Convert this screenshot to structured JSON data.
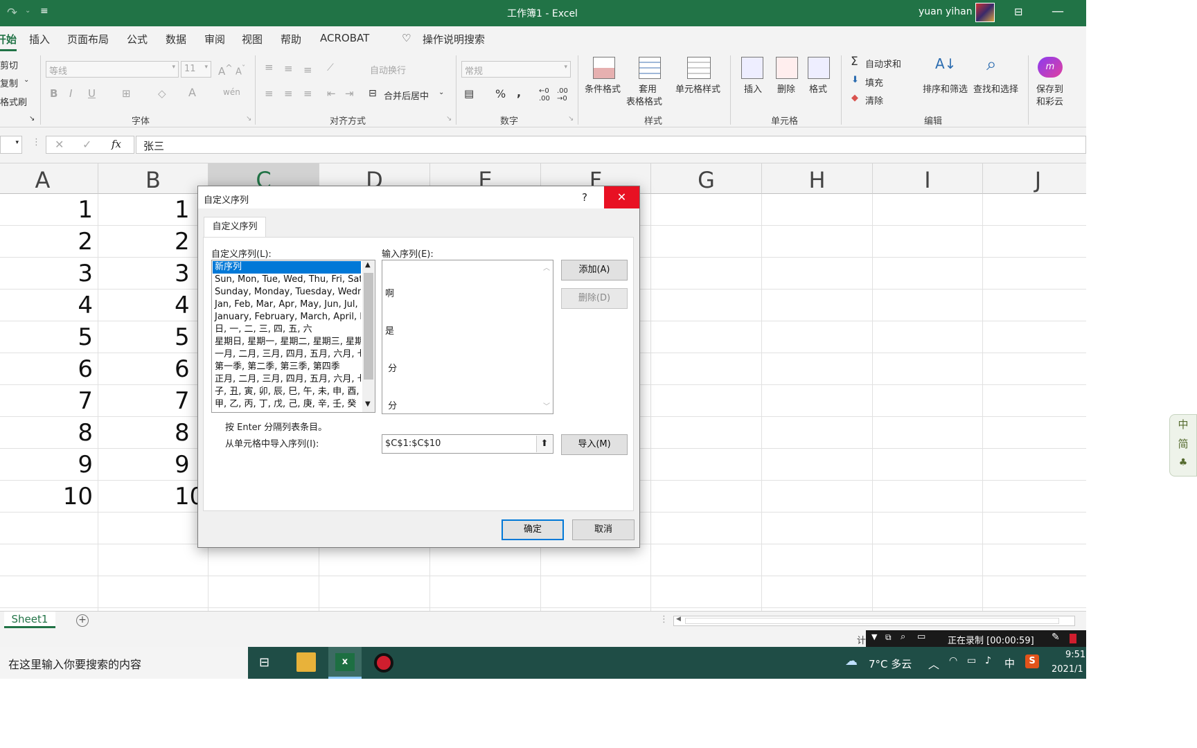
{
  "titlebar": {
    "title": "工作簿1  -  Excel",
    "user": "yuan yihan"
  },
  "tabs": [
    "开始",
    "插入",
    "页面布局",
    "公式",
    "数据",
    "审阅",
    "视图",
    "帮助",
    "ACROBAT"
  ],
  "tell_me": "操作说明搜索",
  "ribbon": {
    "clipboard": {
      "cut": "剪切",
      "copy": "复制",
      "format_painter": "格式刷"
    },
    "font": {
      "label": "字体",
      "font_name": "等线",
      "font_size": "11"
    },
    "align": {
      "label": "对齐方式",
      "wrap": "自动换行",
      "merge": "合并后居中"
    },
    "number": {
      "label": "数字",
      "format": "常规"
    },
    "styles": {
      "label": "样式",
      "cond": "条件格式",
      "table1": "套用",
      "table2": "表格格式",
      "cell_style": "单元格样式"
    },
    "cells": {
      "label": "单元格",
      "insert": "插入",
      "delete": "删除",
      "format": "格式"
    },
    "editing": {
      "label": "编辑",
      "autosum": "自动求和",
      "fill": "填充",
      "clear": "清除",
      "sort": "排序和筛选",
      "find": "查找和选择"
    },
    "save1": "保存到",
    "save2": "和彩云"
  },
  "formula_bar": {
    "content": "张三"
  },
  "columns": [
    "A",
    "B",
    "C",
    "D",
    "E",
    "F",
    "G",
    "H",
    "I",
    "J"
  ],
  "rows": [
    "1",
    "2",
    "3",
    "4",
    "5",
    "6",
    "7",
    "8",
    "9",
    "10"
  ],
  "sheet": {
    "tab": "Sheet1"
  },
  "dialog": {
    "title": "自定义序列",
    "help": "?",
    "tab": "自定义序列",
    "list_label": "自定义序列(L):",
    "list_items": [
      "新序列",
      "Sun, Mon, Tue, Wed, Thu, Fri, Sat",
      "Sunday, Monday, Tuesday, Wednesday",
      "Jan, Feb, Mar, Apr, May, Jun, Jul, Aug",
      "January, February, March, April, May",
      "日, 一, 二, 三, 四, 五, 六",
      "星期日, 星期一, 星期二, 星期三, 星期四",
      "一月, 二月, 三月, 四月, 五月, 六月, 七月",
      "第一季, 第二季, 第三季, 第四季",
      "正月, 二月, 三月, 四月, 五月, 六月, 七月",
      "子, 丑, 寅, 卯, 辰, 巳, 午, 未, 申, 酉, 戌",
      "甲, 乙, 丙, 丁, 戊, 己, 庚, 辛, 壬, 癸"
    ],
    "entries_label": "输入序列(E):",
    "entries": [
      "啊",
      "是",
      " 分",
      " 分"
    ],
    "add": "添加(A)",
    "delete": "删除(D)",
    "hint": "按 Enter 分隔列表条目。",
    "import_label": "从单元格中导入序列(I):",
    "import_range": "$C$1:$C$10",
    "import": "导入(M)",
    "ok": "确定",
    "cancel": "取消"
  },
  "ime": [
    "中",
    "简"
  ],
  "status": {
    "calc": "计",
    "recording": "正在录制 [00:00:59]"
  },
  "taskbar": {
    "search": "在这里输入你要搜索的内容",
    "weather": "7°C  多云",
    "lang": "中",
    "time": "9:51",
    "date": "2021/1"
  },
  "colors": {
    "excel_green": "#217346",
    "select_blue": "#0078d7",
    "close_red": "#e81123"
  }
}
